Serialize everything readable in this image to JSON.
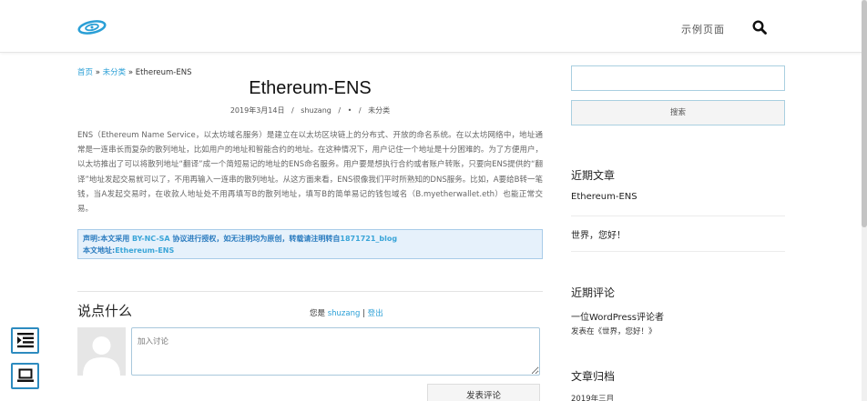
{
  "header": {
    "nav_label": "示例页面",
    "logo_icon": "swirl-logo-icon",
    "search_icon": "search-icon",
    "accent_color": "#2a9fd6"
  },
  "breadcrumb": {
    "home": "首页",
    "sep1": "»",
    "category": "未分类",
    "sep2": "»",
    "current": "Ethereum-ENS"
  },
  "post": {
    "title": "Ethereum-ENS",
    "date": "2019年3月14日",
    "author": "shuzang",
    "sep": "/",
    "dot": "•",
    "category": "未分类",
    "body": "ENS（Ethereum Name Service，以太坊域名服务）是建立在以太坊区块链上的分布式、开放的命名系统。在以太坊网络中，地址通常是一连串长而复杂的散列地址，比如用户的地址和智能合约的地址。在这种情况下，用户记住一个地址是十分困难的。为了方便用户，以太坊推出了可以将散列地址“翻译”成一个简短易记的地址的ENS命名服务。用户要是想执行合约或者账户转账，只要向ENS提供的“翻译”地址发起交易就可以了，不用再输入一连串的散列地址。从这方面来看，ENS很像我们平时所熟知的DNS服务。比如，A要给B转一笔钱，当A发起交易时，在收款人地址处不用再填写B的散列地址，填写B的简单易记的钱包域名（B.myetherwallet.eth）也能正常交易。"
  },
  "notice": {
    "line1_prefix": "声明:本文采用",
    "license": "BY-NC-SA",
    "line1_middle": "协议进行授权，如无注明均为原创，转载请注明转自",
    "blog": "1871721_blog",
    "line2_label": "本文地址:",
    "line2_link": "Ethereum-ENS"
  },
  "comments": {
    "title": "说点什么",
    "logged_prefix": "您是",
    "user": "shuzang",
    "bar": "|",
    "logout": "登出",
    "placeholder": "加入讨论",
    "submit": "发表评论"
  },
  "sidebar": {
    "search_value": "",
    "search_button": "搜索",
    "recent_posts_title": "近期文章",
    "recent_posts": [
      "Ethereum-ENS",
      "世界，您好！"
    ],
    "recent_comments_title": "近期评论",
    "comment_author": "一位WordPress评论者",
    "comment_on": "发表在《世界，您好！》",
    "archives_title": "文章归档",
    "archive_month": "2019年三月"
  },
  "tools": {
    "indent_icon": "indent-list-icon",
    "laptop_icon": "laptop-icon"
  }
}
